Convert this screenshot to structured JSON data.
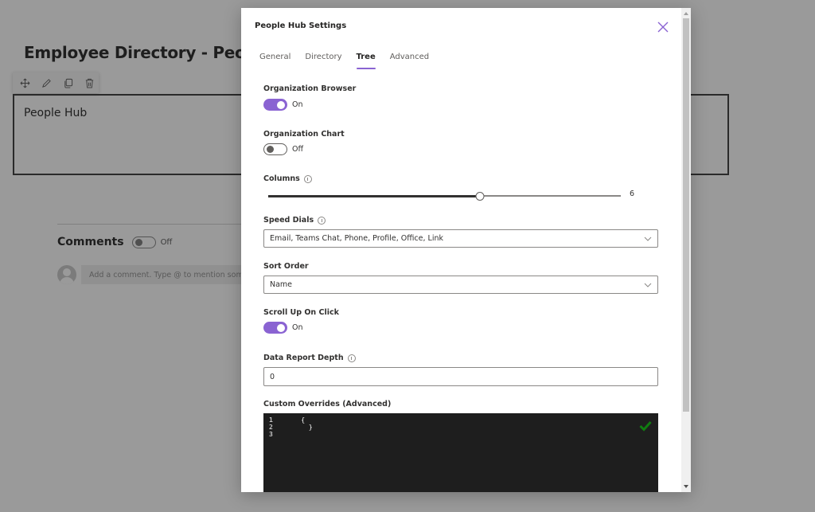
{
  "background_page": {
    "title": "Employee Directory - People H",
    "toolbar_icons": [
      "move-icon",
      "edit-icon",
      "duplicate-icon",
      "delete-icon"
    ],
    "webpart_title": "People Hub",
    "comments": {
      "label": "Comments",
      "toggle_state": "Off",
      "input_placeholder": "Add a comment. Type @ to mention someone"
    }
  },
  "modal": {
    "title": "People Hub Settings",
    "close_icon": "close-icon",
    "tabs": [
      {
        "label": "General",
        "active": false
      },
      {
        "label": "Directory",
        "active": false
      },
      {
        "label": "Tree",
        "active": true
      },
      {
        "label": "Advanced",
        "active": false
      }
    ],
    "fields": {
      "organization_browser": {
        "label": "Organization Browser",
        "value": "On",
        "on": true
      },
      "organization_chart": {
        "label": "Organization Chart",
        "value": "Off",
        "on": false
      },
      "columns": {
        "label": "Columns",
        "value": "6",
        "min": 0,
        "max": 10,
        "current": 6
      },
      "speed_dials": {
        "label": "Speed Dials",
        "value": "Email, Teams Chat, Phone, Profile, Office, Link"
      },
      "sort_order": {
        "label": "Sort Order",
        "value": "Name"
      },
      "scroll_up_on_click": {
        "label": "Scroll Up On Click",
        "value": "On",
        "on": true
      },
      "data_report_depth": {
        "label": "Data Report Depth",
        "value": "0"
      },
      "custom_overrides": {
        "label": "Custom Overrides (Advanced)",
        "lines": [
          {
            "number": "1",
            "content": "    {"
          },
          {
            "number": "2",
            "content": "      }"
          },
          {
            "number": "3",
            "content": ""
          }
        ],
        "valid": true
      }
    }
  },
  "colors": {
    "accent": "#8a63d2",
    "valid_check": "#107c10",
    "overlay": "#9a9a9a",
    "editor_bg": "#1e1e1e"
  }
}
